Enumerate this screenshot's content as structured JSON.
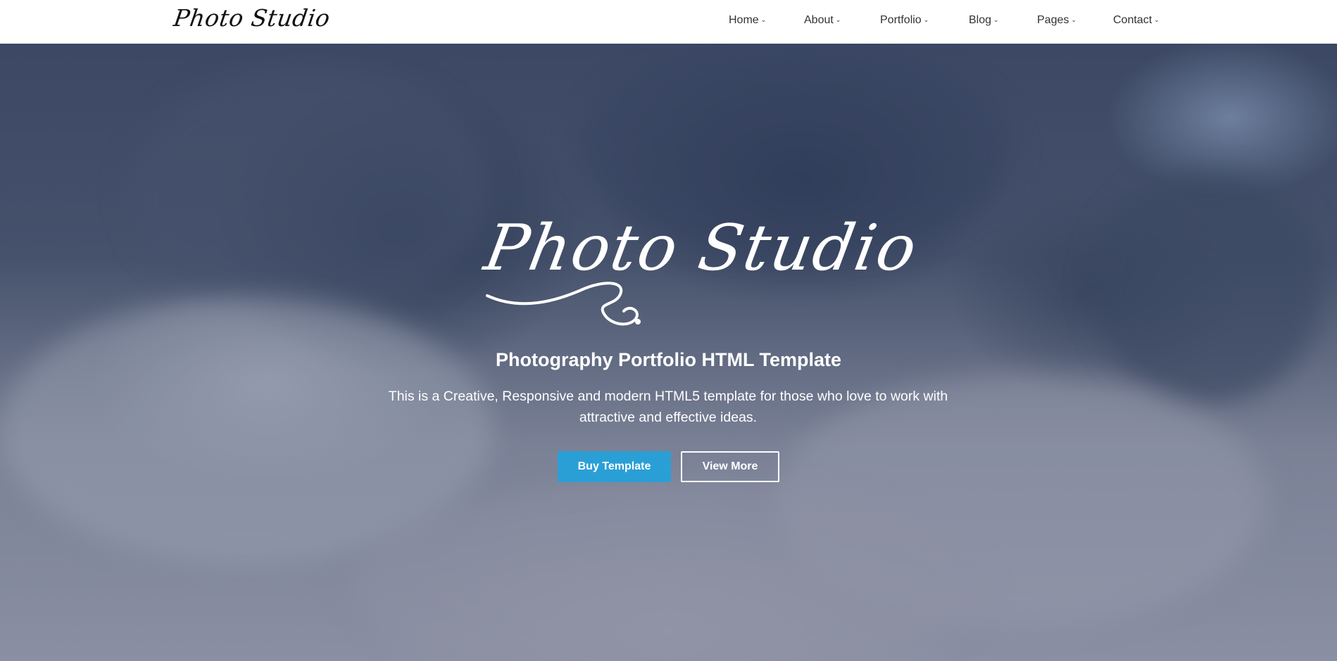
{
  "header": {
    "logo_text": "Photo Studio",
    "nav": [
      {
        "label": "Home"
      },
      {
        "label": "About"
      },
      {
        "label": "Portfolio"
      },
      {
        "label": "Blog"
      },
      {
        "label": "Pages"
      },
      {
        "label": "Contact"
      }
    ],
    "chevron_icon": "chevron-down-icon"
  },
  "hero": {
    "logo_text": "Photo Studio",
    "subtitle": "Photography Portfolio HTML Template",
    "description": "This is a Creative, Responsive and modern HTML5 template for those who love to work with attractive and effective ideas.",
    "buy_button": "Buy Template",
    "view_button": "View More"
  },
  "colors": {
    "accent": "#2a9fd6",
    "nav_text": "#333333",
    "hero_text": "#ffffff"
  }
}
